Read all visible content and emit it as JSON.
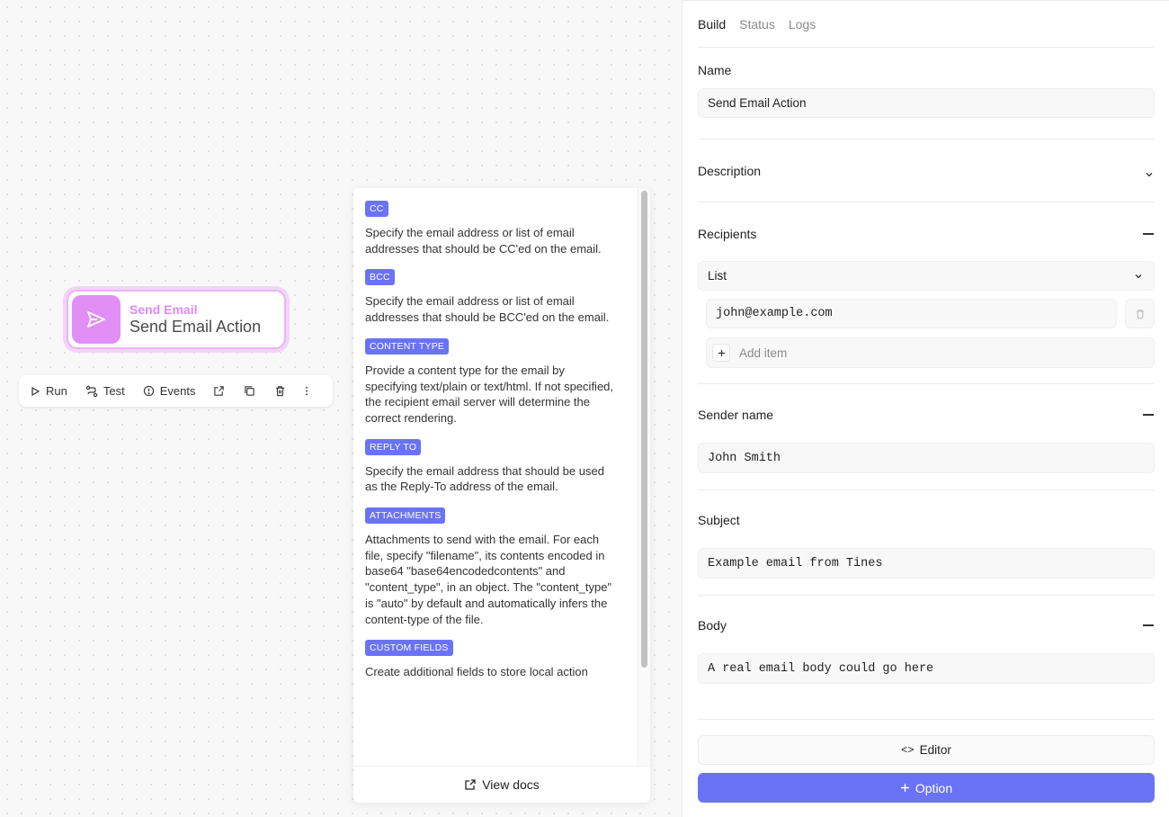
{
  "node": {
    "type_label": "Send Email",
    "name": "Send Email Action",
    "color": "#e18ef6"
  },
  "toolbar": {
    "run": "Run",
    "test": "Test",
    "events": "Events"
  },
  "docs": {
    "items": [
      {
        "tag": "CC",
        "text": "Specify the email address or list of email addresses that should be CC'ed on the email."
      },
      {
        "tag": "BCC",
        "text": "Specify the email address or list of email addresses that should be BCC'ed on the email."
      },
      {
        "tag": "CONTENT TYPE",
        "text": "Provide a content type for the email by specifying text/plain or text/html. If not specified, the recipient email server will determine the correct rendering."
      },
      {
        "tag": "REPLY TO",
        "text": "Specify the email address that should be used as the Reply-To address of the email."
      },
      {
        "tag": "ATTACHMENTS",
        "text": "Attachments to send with the email. For each file, specify \"filename\", its contents encoded in base64 \"base64encodedcontents\" and \"content_type\", in an object. The \"content_type\" is \"auto\" by default and automatically infers the content-type of the file."
      },
      {
        "tag": "CUSTOM FIELDS",
        "text": "Create additional fields to store local action"
      }
    ],
    "view_docs": "View docs"
  },
  "panel": {
    "tabs": [
      "Build",
      "Status",
      "Logs"
    ],
    "name_label": "Name",
    "name_value": "Send Email Action",
    "description_label": "Description",
    "recipients_label": "Recipients",
    "recipients_type": "List",
    "recipients_items": [
      "john@example.com"
    ],
    "add_item": "Add item",
    "sender_label": "Sender name",
    "sender_value": "John Smith",
    "subject_label": "Subject",
    "subject_value": "Example email from Tines",
    "body_label": "Body",
    "body_value": "A real email body could go here",
    "editor_btn": "Editor",
    "option_btn": "Option"
  },
  "colors": {
    "accent": "#6a73f5",
    "node": "#e18ef6"
  }
}
